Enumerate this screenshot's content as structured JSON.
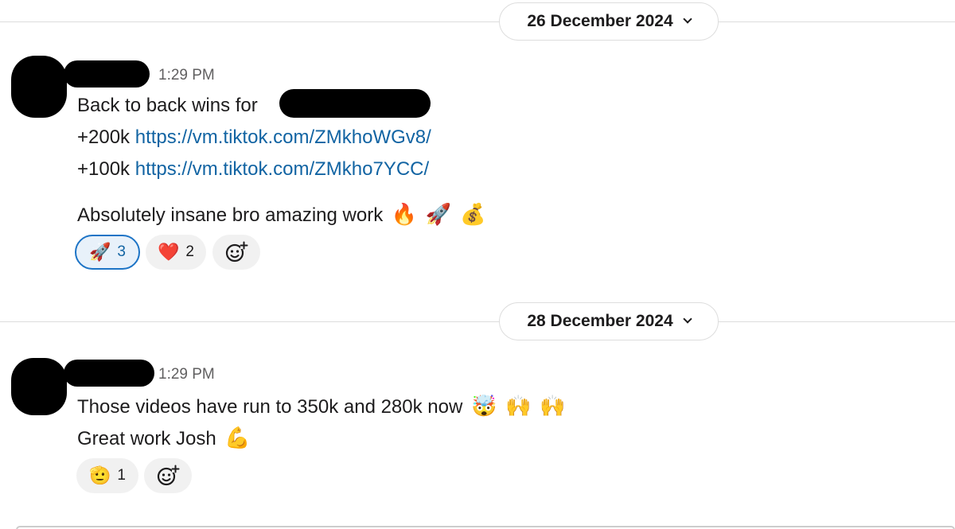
{
  "dividers": [
    {
      "date_label": "26 December 2024"
    },
    {
      "date_label": "28 December 2024"
    }
  ],
  "messages": [
    {
      "timestamp": "1:29 PM",
      "line1": "Back to back wins for",
      "line2_prefix": "+200k",
      "line2_link": "https://vm.tiktok.com/ZMkhoWGv8/",
      "line3_prefix": "+100k",
      "line3_link": "https://vm.tiktok.com/ZMkho7YCC/",
      "line4": "Absolutely insane bro amazing work",
      "line4_emojis": [
        "🔥",
        "🚀",
        "💰"
      ],
      "reactions": [
        {
          "emoji": "🚀",
          "count": "3",
          "active": true
        },
        {
          "emoji": "❤️",
          "count": "2",
          "active": false
        }
      ]
    },
    {
      "timestamp": "1:29 PM",
      "line1": "Those videos have run to 350k and 280k now",
      "line1_emojis": [
        "🤯",
        "🙌",
        "🙌"
      ],
      "line2": "Great work Josh",
      "line2_emojis": [
        "💪"
      ],
      "reactions": [
        {
          "emoji": "🫡",
          "count": "1",
          "active": false
        }
      ]
    }
  ],
  "colors": {
    "link": "#1264a3",
    "reaction_active_border": "#1d74c6",
    "reaction_active_bg": "#e8f1fa",
    "reaction_bg": "#f1f1f1",
    "timestamp": "#616061"
  },
  "icons": {
    "add_reaction": "add-reaction-icon",
    "date_dropdown": "chevron-down-icon"
  }
}
